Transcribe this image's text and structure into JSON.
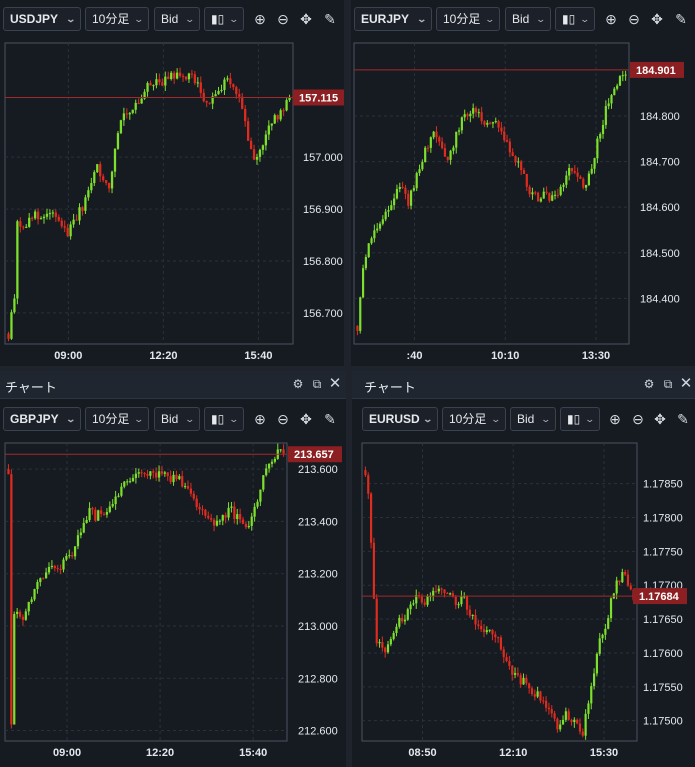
{
  "panels": [
    {
      "symbol": "USDJPY",
      "title": "",
      "timeframe": "10分足",
      "price_type": "Bid",
      "last_price": "157.115",
      "last_value": 157.115,
      "yticks": [
        "157.000",
        "156.900",
        "156.800",
        "156.700"
      ],
      "xticks": [
        "09:00",
        "12:20",
        "15:40"
      ]
    },
    {
      "symbol": "EURJPY",
      "title": "",
      "timeframe": "10分足",
      "price_type": "Bid",
      "last_price": "184.901",
      "last_value": 184.901,
      "yticks": [
        "184.800",
        "184.700",
        "184.600",
        "184.500",
        "184.400"
      ],
      "xticks": [
        ":40",
        "10:10",
        "13:30"
      ]
    },
    {
      "symbol": "GBPJPY",
      "title": "チャート",
      "timeframe": "10分足",
      "price_type": "Bid",
      "last_price": "213.657",
      "last_value": 213.657,
      "yticks": [
        "213.600",
        "213.400",
        "213.200",
        "213.000",
        "212.800",
        "212.600"
      ],
      "xticks": [
        "09:00",
        "12:20",
        "15:40"
      ]
    },
    {
      "symbol": "EURUSD",
      "title": "チャート",
      "timeframe": "10分足",
      "price_type": "Bid",
      "last_price": "1.17684",
      "last_value": 1.17684,
      "yticks": [
        "1.17850",
        "1.17800",
        "1.17750",
        "1.17700",
        "1.17650",
        "1.17600",
        "1.17550",
        "1.17500"
      ],
      "xticks": [
        "08:50",
        "12:10",
        "15:30"
      ]
    }
  ],
  "icons": {
    "candle": "candlestick-icon",
    "zoom_in": "zoom-in-icon",
    "zoom_out": "zoom-out-icon",
    "move": "move-icon",
    "draw": "draw-icon",
    "settings": "gear-icon",
    "popout": "popout-icon",
    "close": "close-icon"
  },
  "colors": {
    "up": "#7ee02c",
    "down": "#e02b1f",
    "price_line": "#a12a2a",
    "price_label": "#8b1f22",
    "background": "#161b22",
    "grid": "#2a313b"
  },
  "chart_data": [
    {
      "type": "candlestick",
      "symbol": "USDJPY",
      "timeframe": "10分足",
      "x": [
        "09:00",
        "12:20",
        "15:40"
      ],
      "ylim": [
        156.64,
        157.22
      ],
      "y_ticks": [
        157.0,
        156.9,
        156.8,
        156.7
      ],
      "last": 157.115,
      "close_path": [
        [
          0.0,
          156.66
        ],
        [
          0.02,
          156.72
        ],
        [
          0.03,
          156.88
        ],
        [
          0.05,
          156.86
        ],
        [
          0.08,
          156.89
        ],
        [
          0.12,
          156.88
        ],
        [
          0.16,
          156.89
        ],
        [
          0.19,
          156.87
        ],
        [
          0.21,
          156.85
        ],
        [
          0.23,
          156.88
        ],
        [
          0.26,
          156.9
        ],
        [
          0.29,
          156.94
        ],
        [
          0.31,
          156.99
        ],
        [
          0.33,
          156.96
        ],
        [
          0.36,
          156.94
        ],
        [
          0.38,
          157.02
        ],
        [
          0.4,
          157.08
        ],
        [
          0.43,
          157.09
        ],
        [
          0.46,
          157.1
        ],
        [
          0.49,
          157.13
        ],
        [
          0.52,
          157.15
        ],
        [
          0.55,
          157.14
        ],
        [
          0.58,
          157.16
        ],
        [
          0.62,
          157.15
        ],
        [
          0.65,
          157.16
        ],
        [
          0.68,
          157.13
        ],
        [
          0.71,
          157.1
        ],
        [
          0.74,
          157.12
        ],
        [
          0.77,
          157.15
        ],
        [
          0.8,
          157.14
        ],
        [
          0.83,
          157.1
        ],
        [
          0.85,
          157.04
        ],
        [
          0.87,
          156.99
        ],
        [
          0.9,
          157.02
        ],
        [
          0.93,
          157.06
        ],
        [
          0.96,
          157.08
        ],
        [
          1.0,
          157.115
        ]
      ]
    },
    {
      "type": "candlestick",
      "symbol": "EURJPY",
      "timeframe": "10分足",
      "x": [
        ":40",
        "10:10",
        "13:30"
      ],
      "ylim": [
        184.3,
        184.96
      ],
      "y_ticks": [
        184.8,
        184.7,
        184.6,
        184.5,
        184.4
      ],
      "last": 184.901,
      "close_path": [
        [
          0.0,
          184.34
        ],
        [
          0.02,
          184.46
        ],
        [
          0.04,
          184.53
        ],
        [
          0.07,
          184.56
        ],
        [
          0.1,
          184.58
        ],
        [
          0.13,
          184.62
        ],
        [
          0.16,
          184.64
        ],
        [
          0.19,
          184.61
        ],
        [
          0.22,
          184.67
        ],
        [
          0.25,
          184.72
        ],
        [
          0.28,
          184.76
        ],
        [
          0.31,
          184.74
        ],
        [
          0.34,
          184.7
        ],
        [
          0.37,
          184.76
        ],
        [
          0.4,
          184.8
        ],
        [
          0.43,
          184.82
        ],
        [
          0.46,
          184.8
        ],
        [
          0.49,
          184.78
        ],
        [
          0.52,
          184.78
        ],
        [
          0.55,
          184.74
        ],
        [
          0.58,
          184.72
        ],
        [
          0.61,
          184.68
        ],
        [
          0.64,
          184.64
        ],
        [
          0.67,
          184.62
        ],
        [
          0.7,
          184.63
        ],
        [
          0.73,
          184.62
        ],
        [
          0.76,
          184.64
        ],
        [
          0.79,
          184.68
        ],
        [
          0.82,
          184.67
        ],
        [
          0.85,
          184.64
        ],
        [
          0.88,
          184.7
        ],
        [
          0.91,
          184.78
        ],
        [
          0.94,
          184.84
        ],
        [
          0.97,
          184.88
        ],
        [
          1.0,
          184.901
        ]
      ]
    },
    {
      "type": "candlestick",
      "symbol": "GBPJPY",
      "timeframe": "10分足",
      "x": [
        "09:00",
        "12:20",
        "15:40"
      ],
      "ylim": [
        212.56,
        213.7
      ],
      "y_ticks": [
        213.6,
        213.4,
        213.2,
        213.0,
        212.8,
        212.6
      ],
      "last": 213.657,
      "close_path": [
        [
          0.0,
          213.6
        ],
        [
          0.01,
          212.58
        ],
        [
          0.02,
          213.06
        ],
        [
          0.05,
          213.02
        ],
        [
          0.08,
          213.1
        ],
        [
          0.12,
          213.18
        ],
        [
          0.16,
          213.22
        ],
        [
          0.2,
          213.24
        ],
        [
          0.23,
          213.28
        ],
        [
          0.26,
          213.36
        ],
        [
          0.29,
          213.44
        ],
        [
          0.32,
          213.42
        ],
        [
          0.35,
          213.44
        ],
        [
          0.38,
          213.48
        ],
        [
          0.41,
          213.52
        ],
        [
          0.44,
          213.56
        ],
        [
          0.47,
          213.58
        ],
        [
          0.5,
          213.59
        ],
        [
          0.53,
          213.58
        ],
        [
          0.56,
          213.57
        ],
        [
          0.6,
          213.57
        ],
        [
          0.63,
          213.55
        ],
        [
          0.66,
          213.52
        ],
        [
          0.69,
          213.46
        ],
        [
          0.72,
          213.41
        ],
        [
          0.75,
          213.4
        ],
        [
          0.78,
          213.42
        ],
        [
          0.81,
          213.44
        ],
        [
          0.84,
          213.4
        ],
        [
          0.86,
          213.36
        ],
        [
          0.89,
          213.44
        ],
        [
          0.92,
          213.54
        ],
        [
          0.95,
          213.62
        ],
        [
          0.98,
          213.66
        ],
        [
          1.0,
          213.657
        ]
      ]
    },
    {
      "type": "candlestick",
      "symbol": "EURUSD",
      "timeframe": "10分足",
      "x": [
        "08:50",
        "12:10",
        "15:30"
      ],
      "ylim": [
        1.1747,
        1.1791
      ],
      "y_ticks": [
        1.1785,
        1.178,
        1.1775,
        1.177,
        1.1765,
        1.176,
        1.1755,
        1.175
      ],
      "last": 1.17684,
      "close_path": [
        [
          0.0,
          1.1787
        ],
        [
          0.01,
          1.1784
        ],
        [
          0.04,
          1.1762
        ],
        [
          0.07,
          1.176
        ],
        [
          0.1,
          1.1763
        ],
        [
          0.13,
          1.1765
        ],
        [
          0.16,
          1.1766
        ],
        [
          0.19,
          1.1768
        ],
        [
          0.22,
          1.1767
        ],
        [
          0.25,
          1.1769
        ],
        [
          0.28,
          1.177
        ],
        [
          0.31,
          1.1769
        ],
        [
          0.34,
          1.1767
        ],
        [
          0.37,
          1.1768
        ],
        [
          0.4,
          1.1765
        ],
        [
          0.43,
          1.1763
        ],
        [
          0.46,
          1.1764
        ],
        [
          0.49,
          1.1762
        ],
        [
          0.52,
          1.1759
        ],
        [
          0.55,
          1.1757
        ],
        [
          0.58,
          1.1756
        ],
        [
          0.61,
          1.1755
        ],
        [
          0.64,
          1.1754
        ],
        [
          0.67,
          1.1752
        ],
        [
          0.7,
          1.175
        ],
        [
          0.72,
          1.1749
        ],
        [
          0.75,
          1.1751
        ],
        [
          0.78,
          1.175
        ],
        [
          0.81,
          1.1748
        ],
        [
          0.84,
          1.1755
        ],
        [
          0.87,
          1.1761
        ],
        [
          0.9,
          1.1765
        ],
        [
          0.93,
          1.177
        ],
        [
          0.96,
          1.1772
        ],
        [
          1.0,
          1.17684
        ]
      ]
    }
  ]
}
